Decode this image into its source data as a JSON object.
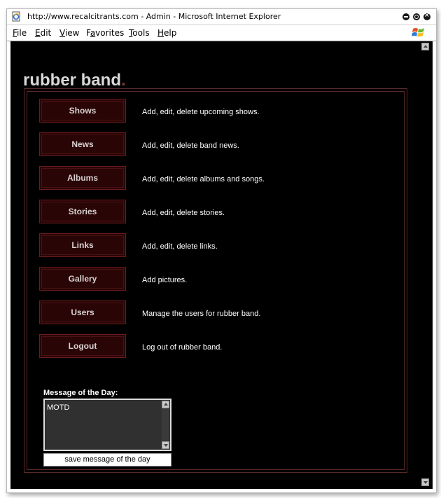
{
  "window": {
    "title": "http://www.recalcitrants.com - Admin - Microsoft Internet Explorer"
  },
  "menubar": {
    "items": [
      {
        "label": "File",
        "accel": "F"
      },
      {
        "label": "Edit",
        "accel": "E"
      },
      {
        "label": "View",
        "accel": "V"
      },
      {
        "label": "Favorites",
        "accel": "a"
      },
      {
        "label": "Tools",
        "accel": "T"
      },
      {
        "label": "Help",
        "accel": "H"
      }
    ]
  },
  "site": {
    "logo_text": "rubber band",
    "logo_dot": "."
  },
  "nav": [
    {
      "label": "Shows",
      "description": "Add, edit, delete upcoming shows."
    },
    {
      "label": "News",
      "description": "Add, edit, delete band news."
    },
    {
      "label": "Albums",
      "description": "Add, edit, delete albums and songs."
    },
    {
      "label": "Stories",
      "description": "Add, edit, delete stories."
    },
    {
      "label": "Links",
      "description": "Add, edit, delete links."
    },
    {
      "label": "Gallery",
      "description": "Add pictures."
    },
    {
      "label": "Users",
      "description": "Manage the users for rubber band."
    },
    {
      "label": "Logout",
      "description": "Log out of rubber band."
    }
  ],
  "motd": {
    "label": "Message of the Day:",
    "value": "MOTD",
    "save_label": "save message of the day"
  },
  "colors": {
    "page_background": "#000000",
    "button_fill": "#2a0506",
    "button_border": "#6a1c1c",
    "panel_border": "#5a2a2a",
    "logo_dot": "#7a3a3a"
  },
  "icons": {
    "app": "ie-page-icon",
    "minimize": "minimize-icon",
    "maximize": "maximize-icon",
    "close": "close-icon",
    "brand": "windows-logo-icon"
  }
}
